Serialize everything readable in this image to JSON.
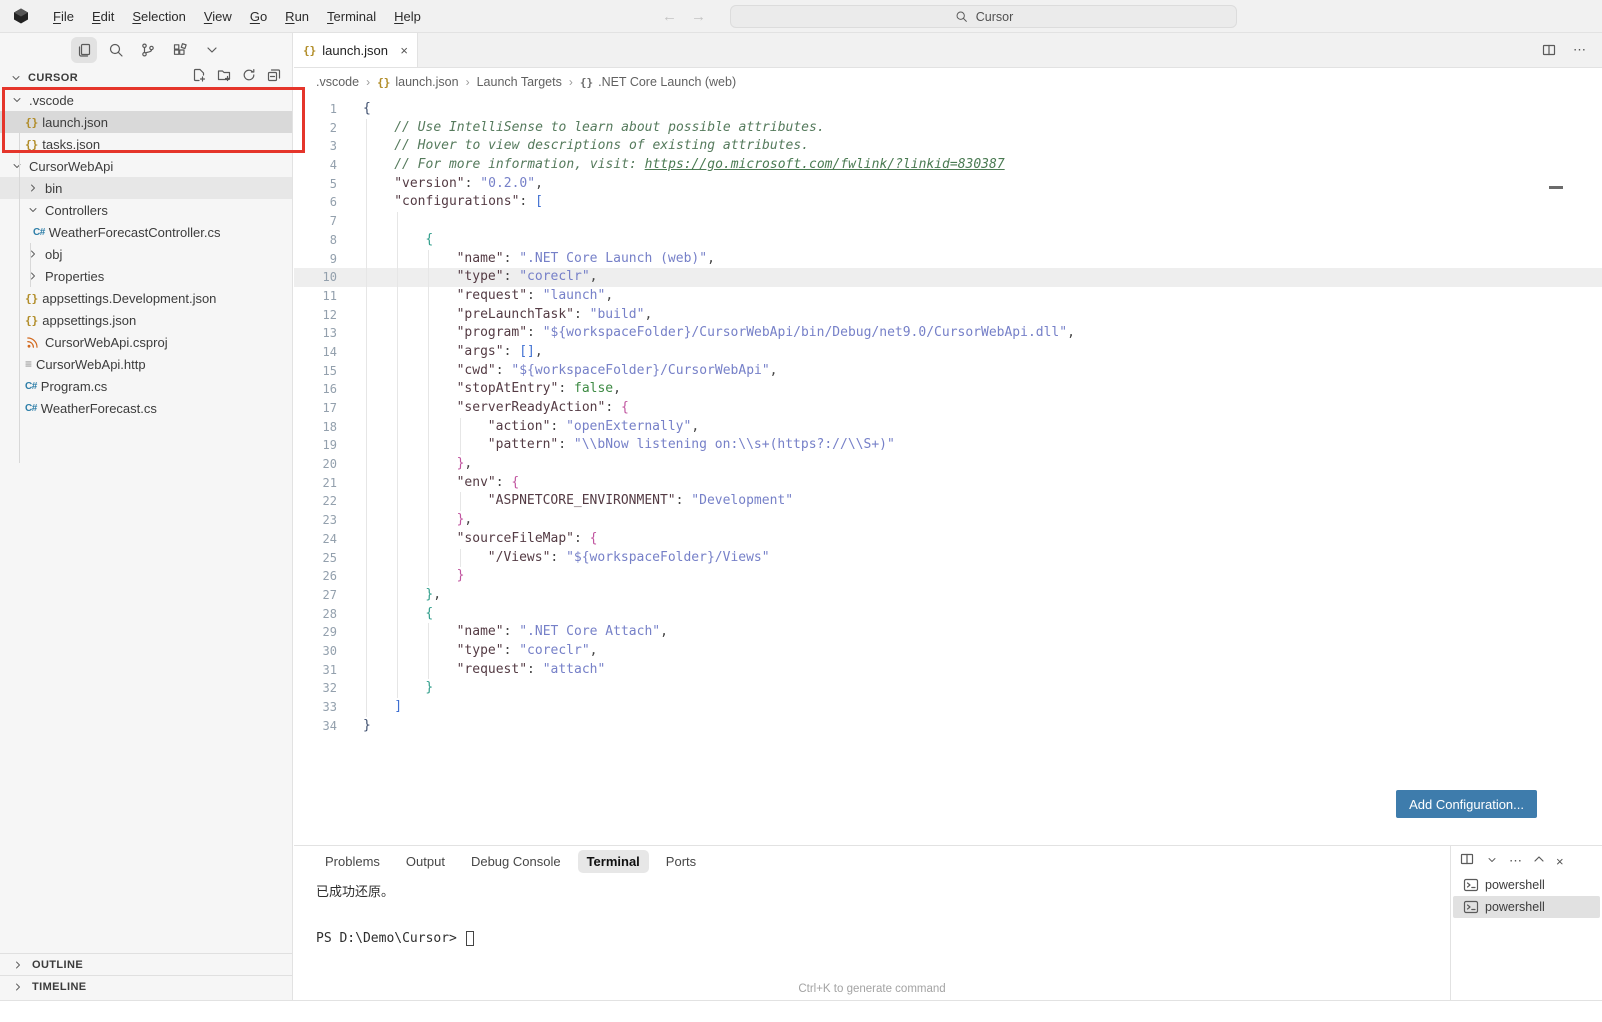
{
  "titlebar": {
    "menus": [
      "File",
      "Edit",
      "Selection",
      "View",
      "Go",
      "Run",
      "Terminal",
      "Help"
    ],
    "search_label": "Cursor",
    "nav": {
      "back": "←",
      "forward": "→"
    }
  },
  "activity_bar": {
    "icons": [
      {
        "name": "files",
        "active": true
      },
      {
        "name": "search"
      },
      {
        "name": "source-control"
      },
      {
        "name": "extensions"
      },
      {
        "name": "chevron-down"
      }
    ]
  },
  "explorer": {
    "title": "CURSOR",
    "actions": [
      "new-file",
      "new-folder",
      "refresh",
      "collapse-all"
    ],
    "tree": [
      {
        "label": ".vscode",
        "icon": "chevron-down",
        "level": 0
      },
      {
        "label": "launch.json",
        "icon": "json",
        "level": 1,
        "selected": true
      },
      {
        "label": "tasks.json",
        "icon": "json",
        "level": 1
      },
      {
        "label": "CursorWebApi",
        "icon": "chevron-down",
        "level": 0
      },
      {
        "label": "bin",
        "icon": "chevron-right",
        "level": 1,
        "hover": true
      },
      {
        "label": "Controllers",
        "icon": "chevron-down",
        "level": 1
      },
      {
        "label": "WeatherForecastController.cs",
        "icon": "csharp",
        "level": 2
      },
      {
        "label": "obj",
        "icon": "chevron-right",
        "level": 1
      },
      {
        "label": "Properties",
        "icon": "chevron-right",
        "level": 1
      },
      {
        "label": "appsettings.Development.json",
        "icon": "json",
        "level": 1
      },
      {
        "label": "appsettings.json",
        "icon": "json",
        "level": 1
      },
      {
        "label": "CursorWebApi.csproj",
        "icon": "rss",
        "level": 1
      },
      {
        "label": "CursorWebApi.http",
        "icon": "http",
        "level": 1
      },
      {
        "label": "Program.cs",
        "icon": "csharp",
        "level": 1
      },
      {
        "label": "WeatherForecast.cs",
        "icon": "csharp",
        "level": 1
      }
    ],
    "sections": [
      "OUTLINE",
      "TIMELINE"
    ]
  },
  "editor": {
    "tab": {
      "label": "launch.json",
      "icon": "json",
      "close": "×"
    },
    "breadcrumb": [
      {
        "label": ".vscode"
      },
      {
        "label": "launch.json",
        "icon": "json"
      },
      {
        "label": "Launch Targets"
      },
      {
        "label": ".NET Core Launch (web)",
        "icon": "json-gray"
      }
    ],
    "add_configuration_label": "Add Configuration...",
    "code_lines": [
      {
        "n": 1,
        "g": 0,
        "i": 0,
        "s": [
          [
            "{",
            "b1"
          ]
        ]
      },
      {
        "n": 2,
        "g": 1,
        "i": 4,
        "s": [
          [
            "// Use IntelliSense to learn about possible attributes.",
            "cm"
          ]
        ]
      },
      {
        "n": 3,
        "g": 1,
        "i": 4,
        "s": [
          [
            "// Hover to view descriptions of existing attributes.",
            "cm"
          ]
        ]
      },
      {
        "n": 4,
        "g": 1,
        "i": 4,
        "s": [
          [
            "// For more information, visit: ",
            "cm"
          ],
          [
            "https://go.microsoft.com/fwlink/?linkid=830387",
            "lk"
          ]
        ]
      },
      {
        "n": 5,
        "g": 1,
        "i": 4,
        "s": [
          [
            "\"version\"",
            "pk"
          ],
          [
            ": ",
            "pt"
          ],
          [
            "\"0.2.0\"",
            "st"
          ],
          [
            ",",
            "pt"
          ]
        ]
      },
      {
        "n": 6,
        "g": 1,
        "i": 4,
        "s": [
          [
            "\"configurations\"",
            "pk"
          ],
          [
            ": ",
            "pt"
          ],
          [
            "[",
            "b2"
          ]
        ]
      },
      {
        "n": 7,
        "g": 2,
        "i": 0,
        "s": []
      },
      {
        "n": 8,
        "g": 2,
        "i": 8,
        "s": [
          [
            "{",
            "b3"
          ]
        ]
      },
      {
        "n": 9,
        "g": 3,
        "i": 12,
        "s": [
          [
            "\"name\"",
            "pk"
          ],
          [
            ": ",
            "pt"
          ],
          [
            "\".NET Core Launch (web)\"",
            "st"
          ],
          [
            ",",
            "pt"
          ]
        ]
      },
      {
        "n": 10,
        "g": 3,
        "i": 12,
        "cur": true,
        "s": [
          [
            "\"type\"",
            "pk"
          ],
          [
            ": ",
            "pt"
          ],
          [
            "\"coreclr\"",
            "st"
          ],
          [
            ",",
            "pt"
          ]
        ]
      },
      {
        "n": 11,
        "g": 3,
        "i": 12,
        "s": [
          [
            "\"request\"",
            "pk"
          ],
          [
            ": ",
            "pt"
          ],
          [
            "\"launch\"",
            "st"
          ],
          [
            ",",
            "pt"
          ]
        ]
      },
      {
        "n": 12,
        "g": 3,
        "i": 12,
        "s": [
          [
            "\"preLaunchTask\"",
            "pk"
          ],
          [
            ": ",
            "pt"
          ],
          [
            "\"build\"",
            "st"
          ],
          [
            ",",
            "pt"
          ]
        ]
      },
      {
        "n": 13,
        "g": 3,
        "i": 12,
        "s": [
          [
            "\"program\"",
            "pk"
          ],
          [
            ": ",
            "pt"
          ],
          [
            "\"${workspaceFolder}/CursorWebApi/bin/Debug/net9.0/CursorWebApi.dll\"",
            "st"
          ],
          [
            ",",
            "pt"
          ]
        ]
      },
      {
        "n": 14,
        "g": 3,
        "i": 12,
        "s": [
          [
            "\"args\"",
            "pk"
          ],
          [
            ": ",
            "pt"
          ],
          [
            "[]",
            "b2"
          ],
          [
            ",",
            "pt"
          ]
        ]
      },
      {
        "n": 15,
        "g": 3,
        "i": 12,
        "s": [
          [
            "\"cwd\"",
            "pk"
          ],
          [
            ": ",
            "pt"
          ],
          [
            "\"${workspaceFolder}/CursorWebApi\"",
            "st"
          ],
          [
            ",",
            "pt"
          ]
        ]
      },
      {
        "n": 16,
        "g": 3,
        "i": 12,
        "s": [
          [
            "\"stopAtEntry\"",
            "pk"
          ],
          [
            ": ",
            "pt"
          ],
          [
            "false",
            "kw"
          ],
          [
            ",",
            "pt"
          ]
        ]
      },
      {
        "n": 17,
        "g": 3,
        "i": 12,
        "s": [
          [
            "\"serverReadyAction\"",
            "pk"
          ],
          [
            ": ",
            "pt"
          ],
          [
            "{",
            "b4"
          ]
        ]
      },
      {
        "n": 18,
        "g": 4,
        "i": 16,
        "s": [
          [
            "\"action\"",
            "pk"
          ],
          [
            ": ",
            "pt"
          ],
          [
            "\"openExternally\"",
            "st"
          ],
          [
            ",",
            "pt"
          ]
        ]
      },
      {
        "n": 19,
        "g": 4,
        "i": 16,
        "s": [
          [
            "\"pattern\"",
            "pk"
          ],
          [
            ": ",
            "pt"
          ],
          [
            "\"\\\\bNow listening on:\\\\s+(https?://\\\\S+)\"",
            "st"
          ]
        ]
      },
      {
        "n": 20,
        "g": 3,
        "i": 12,
        "s": [
          [
            "}",
            "b4"
          ],
          [
            ",",
            "pt"
          ]
        ]
      },
      {
        "n": 21,
        "g": 3,
        "i": 12,
        "s": [
          [
            "\"env\"",
            "pk"
          ],
          [
            ": ",
            "pt"
          ],
          [
            "{",
            "b4"
          ]
        ]
      },
      {
        "n": 22,
        "g": 4,
        "i": 16,
        "s": [
          [
            "\"ASPNETCORE_ENVIRONMENT\"",
            "pk"
          ],
          [
            ": ",
            "pt"
          ],
          [
            "\"Development\"",
            "st"
          ]
        ]
      },
      {
        "n": 23,
        "g": 3,
        "i": 12,
        "s": [
          [
            "}",
            "b4"
          ],
          [
            ",",
            "pt"
          ]
        ]
      },
      {
        "n": 24,
        "g": 3,
        "i": 12,
        "s": [
          [
            "\"sourceFileMap\"",
            "pk"
          ],
          [
            ": ",
            "pt"
          ],
          [
            "{",
            "b4"
          ]
        ]
      },
      {
        "n": 25,
        "g": 4,
        "i": 16,
        "s": [
          [
            "\"/Views\"",
            "pk"
          ],
          [
            ": ",
            "pt"
          ],
          [
            "\"${workspaceFolder}/Views\"",
            "st"
          ]
        ]
      },
      {
        "n": 26,
        "g": 3,
        "i": 12,
        "s": [
          [
            "}",
            "b4"
          ]
        ]
      },
      {
        "n": 27,
        "g": 2,
        "i": 8,
        "s": [
          [
            "}",
            "b3"
          ],
          [
            ",",
            "pt"
          ]
        ]
      },
      {
        "n": 28,
        "g": 2,
        "i": 8,
        "s": [
          [
            "{",
            "b3"
          ]
        ]
      },
      {
        "n": 29,
        "g": 3,
        "i": 12,
        "s": [
          [
            "\"name\"",
            "pk"
          ],
          [
            ": ",
            "pt"
          ],
          [
            "\".NET Core Attach\"",
            "st"
          ],
          [
            ",",
            "pt"
          ]
        ]
      },
      {
        "n": 30,
        "g": 3,
        "i": 12,
        "s": [
          [
            "\"type\"",
            "pk"
          ],
          [
            ": ",
            "pt"
          ],
          [
            "\"coreclr\"",
            "st"
          ],
          [
            ",",
            "pt"
          ]
        ]
      },
      {
        "n": 31,
        "g": 3,
        "i": 12,
        "s": [
          [
            "\"request\"",
            "pk"
          ],
          [
            ": ",
            "pt"
          ],
          [
            "\"attach\"",
            "st"
          ]
        ]
      },
      {
        "n": 32,
        "g": 2,
        "i": 8,
        "s": [
          [
            "}",
            "b3"
          ]
        ]
      },
      {
        "n": 33,
        "g": 1,
        "i": 4,
        "s": [
          [
            "]",
            "b2"
          ]
        ]
      },
      {
        "n": 34,
        "g": 0,
        "i": 0,
        "s": [
          [
            "}",
            "b1"
          ]
        ]
      }
    ]
  },
  "panel": {
    "tabs": [
      "Problems",
      "Output",
      "Debug Console",
      "Terminal",
      "Ports"
    ],
    "active_tab": "Terminal",
    "terminal": {
      "output": "已成功还原。",
      "prompt": "PS D:\\Demo\\Cursor>",
      "hint": "Ctrl+K to generate command",
      "list": [
        {
          "label": "powershell"
        },
        {
          "label": "powershell",
          "selected": true
        }
      ],
      "header_icons": [
        "split-terminal",
        "chevron-down",
        "ellipsis",
        "chevron-up",
        "close"
      ]
    }
  },
  "colors": {
    "accent_button": "#3e7cac",
    "annotation_red": "#e5352b",
    "selection_gray": "#d9d9d9"
  }
}
